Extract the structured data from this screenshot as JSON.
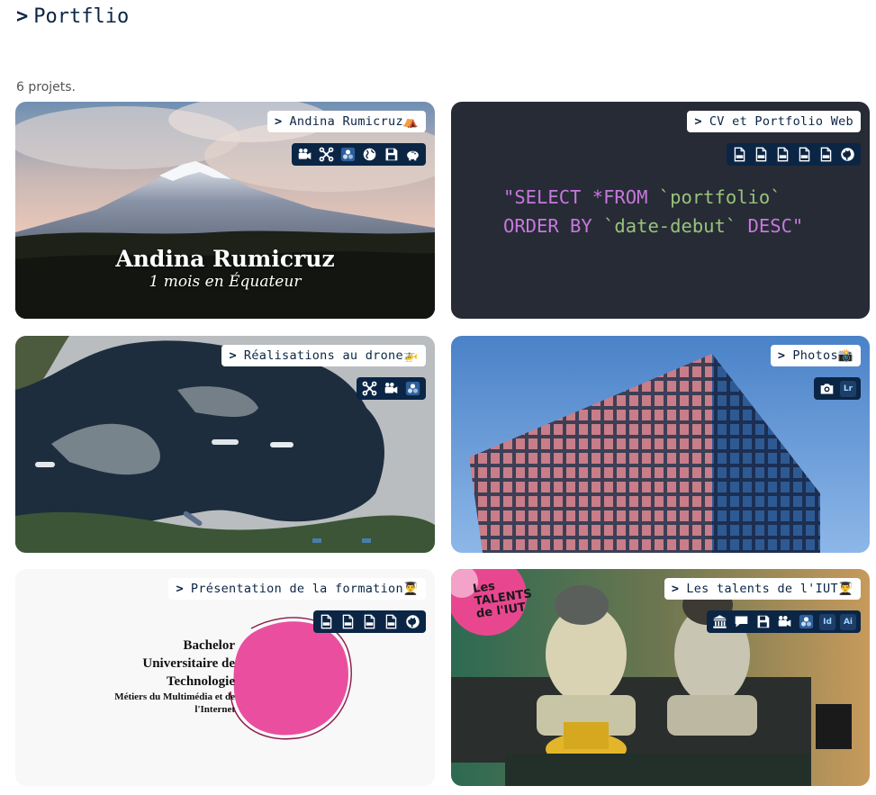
{
  "header": {
    "chevron": ">",
    "title": "Portflio"
  },
  "project_count": "6 projets.",
  "projects": [
    {
      "title": "Andina Rumicruz⛺",
      "hero_title": "Andina Rumicruz",
      "hero_subtitle": "1 mois en Équateur",
      "icons": [
        "video-camera-icon",
        "drone-icon",
        "davinci-resolve-icon",
        "globe-icon",
        "save-icon",
        "piggy-bank-icon"
      ]
    },
    {
      "title": "CV et Portfolio Web",
      "code_line1_a": "\"SELECT *FROM ",
      "code_line1_b": "`portfolio`",
      "code_line2_a": "ORDER BY ",
      "code_line2_b": "`date-debut`",
      "code_line2_c": " DESC\"",
      "icons": [
        "html-file-icon",
        "css-file-icon",
        "php-file-icon",
        "sql-file-icon",
        "js-file-icon",
        "github-icon"
      ]
    },
    {
      "title": "Réalisations au drone🚁",
      "icons": [
        "drone-icon",
        "video-camera-icon",
        "davinci-resolve-icon"
      ]
    },
    {
      "title": "Photos📸",
      "icons": [
        "camera-icon",
        "lightroom-icon"
      ],
      "lightroom_label": "Lr"
    },
    {
      "title": "Présentation de la formation👨‍🎓",
      "doc_line1": "Bachelor",
      "doc_line2": "Universitaire de",
      "doc_line3": "Technologie",
      "doc_line4": "Métiers du Multimédia et de",
      "doc_line5": "l'Internet",
      "icons": [
        "html-file-icon",
        "css-file-icon",
        "php-file-icon",
        "sql-file-icon",
        "github-icon"
      ]
    },
    {
      "title": "Les talents de l'IUT👨‍🎓",
      "logo_text": "Les TALENTS de l'IUT",
      "icons": [
        "museum-icon",
        "chat-icon",
        "save-icon",
        "video-camera-icon",
        "davinci-resolve-icon",
        "indesign-icon",
        "illustrator-icon"
      ],
      "indesign_label": "Id",
      "illustrator_label": "Ai"
    }
  ],
  "colors": {
    "navy": "#0b2545",
    "code_bg": "#272b36",
    "keyword": "#c678dd",
    "string": "#98c379",
    "accent_pink": "#e8478f"
  }
}
